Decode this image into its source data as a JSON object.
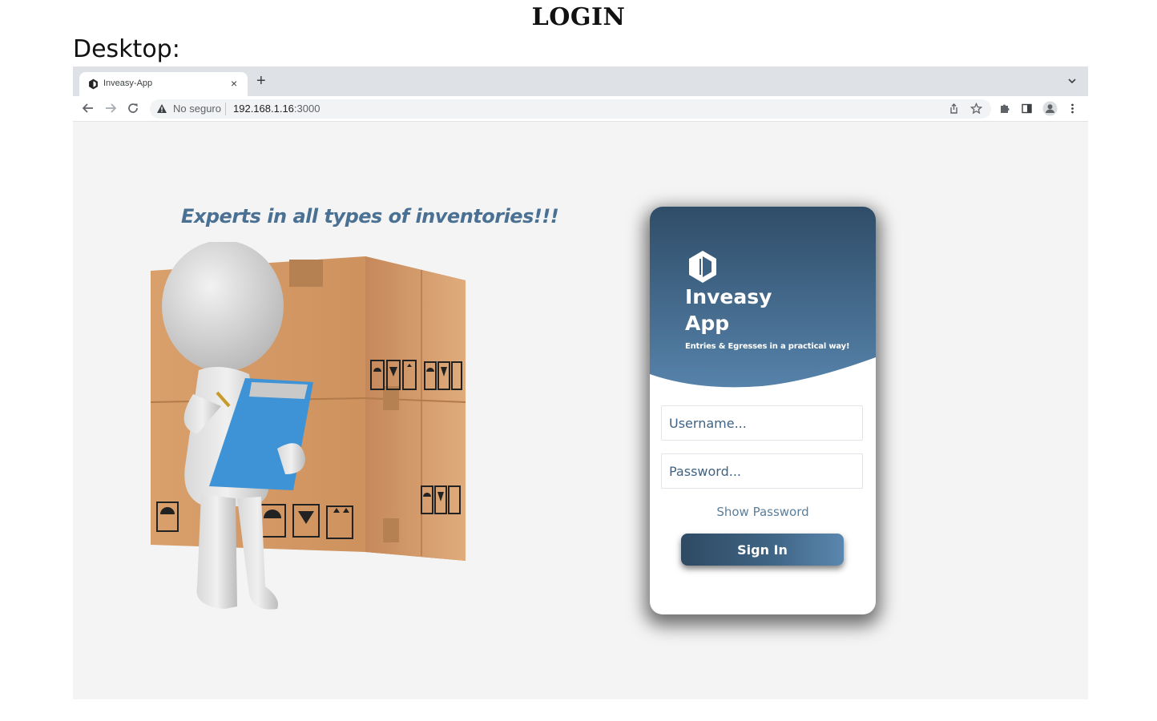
{
  "document": {
    "title": "LOGIN",
    "subtitle": "Desktop:"
  },
  "browser": {
    "tab_title": "Inveasy-App",
    "tab_close": "×",
    "new_tab": "+",
    "not_secure": "No seguro",
    "url_host": "192.168.1.16",
    "url_port": ":3000"
  },
  "page": {
    "tagline": "Experts in all types of inventories!!!",
    "card": {
      "app_name_line1": "Inveasy",
      "app_name_line2": "App",
      "app_tagline": "Entries & Egresses in a practical way!",
      "username_placeholder": "Username...",
      "password_placeholder": "Password...",
      "show_password": "Show Password",
      "signin_label": "Sign In"
    }
  },
  "colors": {
    "header_top": "#2f4d68",
    "header_bottom": "#5682aa",
    "tagline": "#4a7193",
    "page_bg": "#f4f4f4"
  },
  "icons": [
    "cube-logo-icon",
    "close-icon",
    "plus-icon",
    "chevron-down-icon",
    "back-arrow-icon",
    "forward-arrow-icon",
    "reload-icon",
    "warning-icon",
    "share-icon",
    "star-icon",
    "puzzle-icon",
    "side-panel-icon",
    "profile-icon",
    "more-vert-icon"
  ]
}
